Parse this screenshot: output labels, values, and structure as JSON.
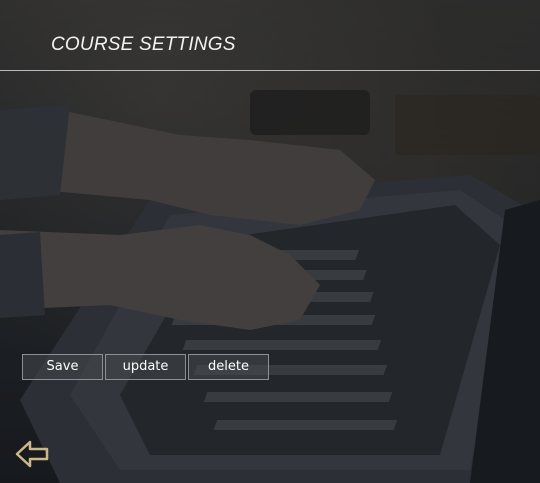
{
  "header": {
    "title": "COURSE SETTINGS"
  },
  "actions": {
    "save_label": "Save",
    "update_label": "update",
    "delete_label": "delete"
  },
  "navigation": {
    "back_icon": "arrow-left-icon"
  },
  "colors": {
    "title": "#f2f2f2",
    "divider": "#b9b9b9",
    "button_border": "#8e8f93",
    "back_arrow": "#c9b98a"
  }
}
